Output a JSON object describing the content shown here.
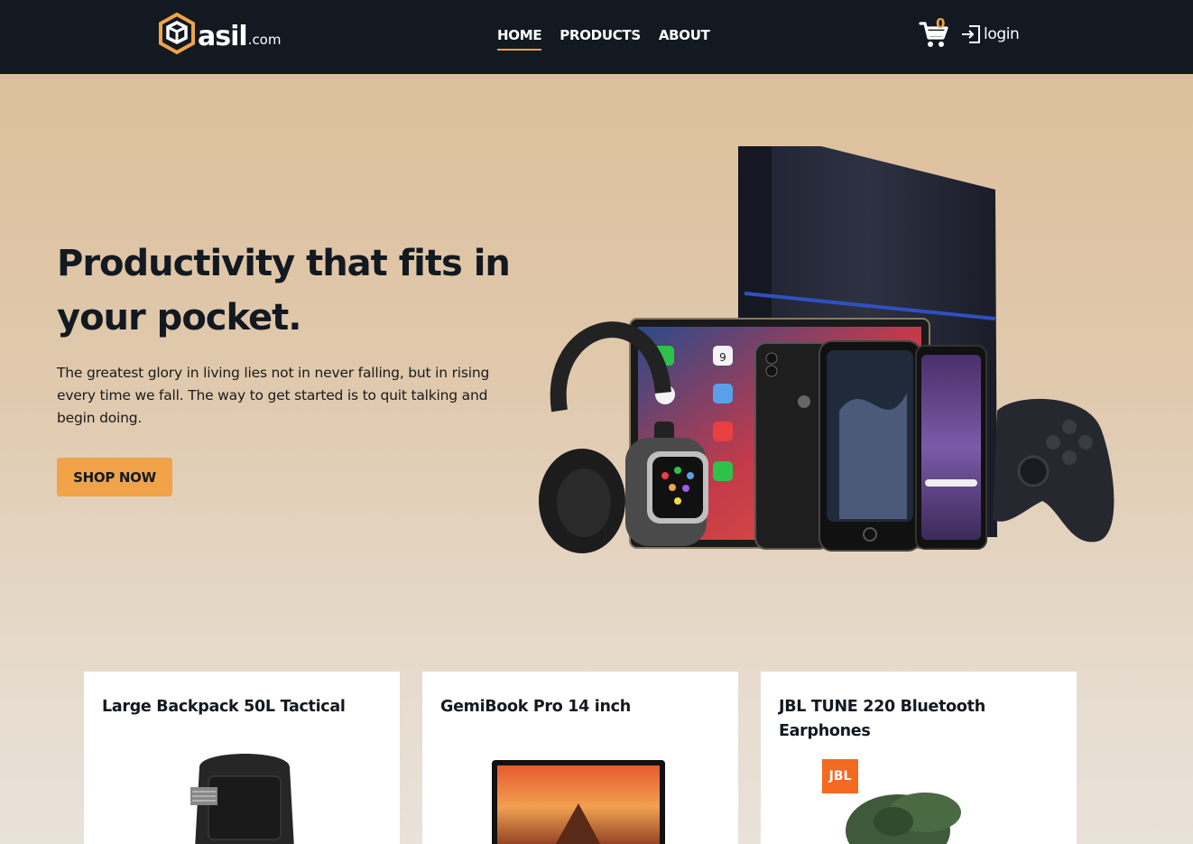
{
  "header": {
    "logo_word": "asil",
    "logo_tld": ".com",
    "nav": [
      "HOME",
      "PRODUCTS",
      "ABOUT"
    ],
    "active_nav": "HOME",
    "cart_count": "0",
    "login_label": "login"
  },
  "hero": {
    "title": "Productivity that fits in your pocket.",
    "text": "The greatest glory in living lies not in never falling, but in rising every time we fall. The way to get started is to quit talking and begin doing.",
    "button_label": "SHOP NOW",
    "phone_date": "9"
  },
  "products": [
    {
      "title": "Large Backpack 50L Tactical"
    },
    {
      "title": "GemiBook Pro 14 inch"
    },
    {
      "title": "JBL TUNE 220 Bluetooth Earphones"
    }
  ],
  "brand_badge": "JBL",
  "colors": {
    "header_bg": "#131921",
    "accent": "#f0a348",
    "hero_bg_top": "#dcbd97",
    "hero_bg_bottom": "#e9e2d9"
  },
  "icons": [
    "logo-icon",
    "cart-icon",
    "login-icon"
  ]
}
